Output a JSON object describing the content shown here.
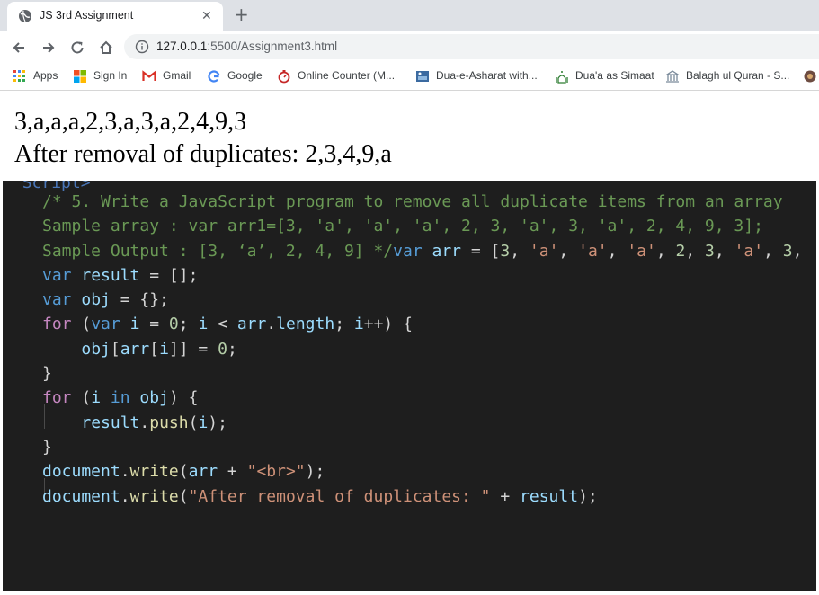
{
  "browser": {
    "tab_title": "JS 3rd Assignment",
    "url_host": "127.0.0.1",
    "url_path": ":5500/Assignment3.html",
    "bookmarks": [
      {
        "label": "Apps",
        "icon": "apps-grid-icon"
      },
      {
        "label": "Sign In",
        "icon": "windows-logo-icon"
      },
      {
        "label": "Gmail",
        "icon": "gmail-icon"
      },
      {
        "label": "Google",
        "icon": "google-icon"
      },
      {
        "label": "Online Counter (M...",
        "icon": "counter-icon"
      },
      {
        "label": "Dua-e-Asharat with...",
        "icon": "site-icon"
      },
      {
        "label": "Dua'a as Simaat",
        "icon": "mosque-icon"
      },
      {
        "label": "Balagh ul Quran - S...",
        "icon": "building-icon"
      }
    ]
  },
  "page": {
    "output_line1": "3,a,a,a,2,3,a,3,a,2,4,9,3",
    "output_line2": "After removal of duplicates: 2,3,4,9,a"
  },
  "code": {
    "cutoff_text": "Script>",
    "comment1": "/* 5. Write a JavaScript program to remove all duplicate items from an array",
    "comment2": "Sample array : var arr1=[3, 'a', 'a', 'a', 2, 3, 'a', 3, 'a', 2, 4, 9, 3];",
    "comment3": "Sample Output : [3, ‘a’, 2, 4, 9] */",
    "kw_var": "var",
    "kw_for": "for",
    "kw_in": "in",
    "id_arr": "arr",
    "id_result": "result",
    "id_obj": "obj",
    "id_i": "i",
    "str_a": "'a'",
    "str_br": "\"<br>\"",
    "str_after": "\"After removal of duplicates: \"",
    "fn_push": "push",
    "fn_write": "write",
    "id_document": "document",
    "prop_length": "length"
  },
  "colors": {
    "code_bg": "#1e1e1e",
    "comment": "#6a9955",
    "keyword": "#569cd6",
    "string": "#ce9178",
    "number": "#b5cea8"
  }
}
